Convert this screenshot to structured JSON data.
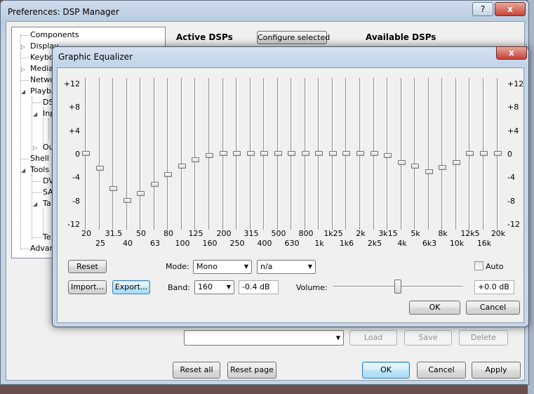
{
  "prefs": {
    "title": "Preferences: DSP Manager",
    "help_label": "?",
    "close_label": "x",
    "tree": [
      {
        "label": "Components"
      },
      {
        "label": "Display"
      },
      {
        "label": "Keybo"
      },
      {
        "label": "Media"
      },
      {
        "label": "Netwo"
      },
      {
        "label": "Playba"
      },
      {
        "label": "DS"
      },
      {
        "label": "Inp"
      },
      {
        "label": "Ou"
      },
      {
        "label": "Shell Ir"
      },
      {
        "label": "Tools"
      },
      {
        "label": "DV"
      },
      {
        "label": "SA"
      },
      {
        "label": "Ta"
      },
      {
        "label": "Te"
      },
      {
        "label": "Advan"
      }
    ],
    "active_dsps": "Active DSPs",
    "configure_selected": "Configure selected",
    "available_dsps": "Available DSPs",
    "preset_buttons": {
      "load": "Load",
      "save": "Save",
      "delete": "Delete"
    },
    "reset_all": "Reset all",
    "reset_page": "Reset page",
    "ok": "OK",
    "cancel": "Cancel",
    "apply": "Apply"
  },
  "eq": {
    "title": "Graphic Equalizer",
    "close_label": "x",
    "db_scale": [
      "+12",
      "+8",
      "+4",
      "0",
      "-4",
      "-8",
      "-12"
    ],
    "db_range": [
      -12,
      12
    ],
    "bands": [
      {
        "freq": "20",
        "gain": 0
      },
      {
        "freq": "25",
        "gain": -2.5
      },
      {
        "freq": "31.5",
        "gain": -6
      },
      {
        "freq": "40",
        "gain": -8
      },
      {
        "freq": "50",
        "gain": -6.8
      },
      {
        "freq": "63",
        "gain": -5.3
      },
      {
        "freq": "80",
        "gain": -3.6
      },
      {
        "freq": "100",
        "gain": -2.1
      },
      {
        "freq": "125",
        "gain": -1.1
      },
      {
        "freq": "160",
        "gain": -0.4
      },
      {
        "freq": "200",
        "gain": 0
      },
      {
        "freq": "250",
        "gain": 0
      },
      {
        "freq": "315",
        "gain": 0
      },
      {
        "freq": "400",
        "gain": 0
      },
      {
        "freq": "500",
        "gain": 0
      },
      {
        "freq": "630",
        "gain": 0
      },
      {
        "freq": "800",
        "gain": 0
      },
      {
        "freq": "1k",
        "gain": 0
      },
      {
        "freq": "1k25",
        "gain": 0
      },
      {
        "freq": "1k6",
        "gain": 0
      },
      {
        "freq": "2k",
        "gain": 0
      },
      {
        "freq": "2k5",
        "gain": 0
      },
      {
        "freq": "3k15",
        "gain": -0.3
      },
      {
        "freq": "4k",
        "gain": -1.6
      },
      {
        "freq": "5k",
        "gain": -2.2
      },
      {
        "freq": "6k3",
        "gain": -3.1
      },
      {
        "freq": "8k",
        "gain": -2.4
      },
      {
        "freq": "10k",
        "gain": -1.5
      },
      {
        "freq": "12k5",
        "gain": 0
      },
      {
        "freq": "16k",
        "gain": 0
      },
      {
        "freq": "20k",
        "gain": 0
      }
    ],
    "reset": "Reset",
    "mode_label": "Mode:",
    "mode_value": "Mono",
    "mode2_value": "n/a",
    "auto_label": "Auto",
    "import": "Import...",
    "export": "Export...",
    "band_label": "Band:",
    "band_value": "160",
    "band_gain": "-0.4 dB",
    "volume_label": "Volume:",
    "volume_value": "+0.0 dB",
    "volume_level_db": 0,
    "ok": "OK",
    "cancel": "Cancel"
  }
}
